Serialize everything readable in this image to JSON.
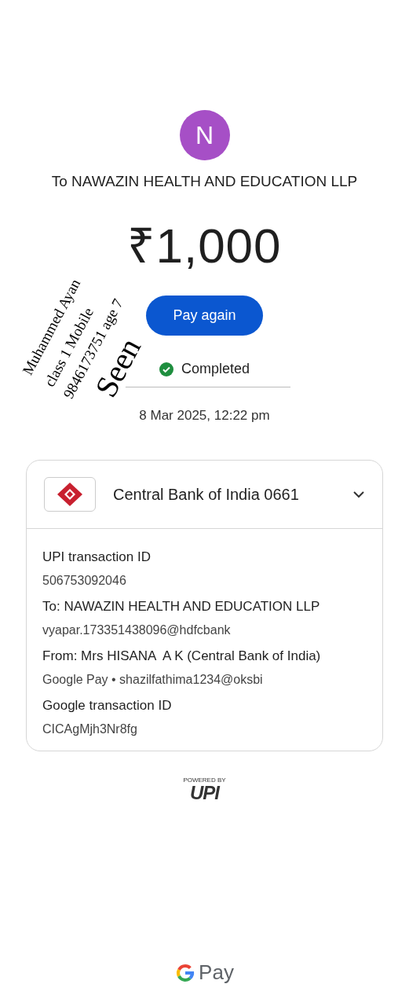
{
  "payee": {
    "initial": "N",
    "title": "To NAWAZIN HEALTH AND EDUCATION LLP"
  },
  "amount": "₹1,000",
  "pay_again": "Pay again",
  "status": {
    "label": "Completed"
  },
  "date": "8 Mar 2025, 12:22 pm",
  "account": {
    "name": "Central Bank of India 0661",
    "expanded": true
  },
  "details": [
    {
      "label": "UPI transaction ID",
      "value": "506753092046"
    },
    {
      "label": "To: NAWAZIN HEALTH AND EDUCATION LLP",
      "value": "vyapar.173351438096@hdfcbank"
    },
    {
      "label": "From: Mrs HISANA  A K (Central Bank of India)",
      "value": "Google Pay • shazilfathima1234@oksbi"
    },
    {
      "label": "Google transaction ID",
      "value": "CICAgMjh3Nr8fg"
    }
  ],
  "upi": {
    "caption": "POWERED BY",
    "logo": "UPI"
  },
  "brand": "Pay",
  "annotation": [
    {
      "kind": "note",
      "text": "Muhammed Ayan"
    },
    {
      "kind": "note",
      "text": "class 1     Mobile"
    },
    {
      "kind": "note",
      "text": "9846173751 age 7"
    },
    {
      "kind": "stamp",
      "text": "Seen"
    }
  ]
}
